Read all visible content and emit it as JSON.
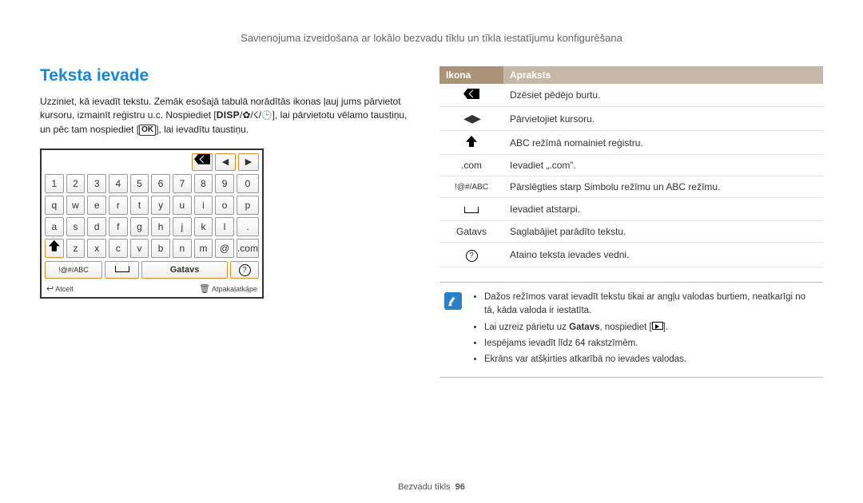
{
  "header": "Savienojuma izveidošana ar lokālo bezvadu tīklu un tīkla iestatījumu konfigurēšana",
  "section_title": "Teksta ievade",
  "intro_seg1": "Uzziniet, kā ievadīt tekstu. Zemāk esošajā tabulā norādītās ikonas ļauj jums pārvietot kursoru, izmainīt reģistru u.c. Nospiediet [",
  "intro_disp": "DISP",
  "intro_seg2": "], lai pārvietotu vēlamo taustiņu, un pēc tam nospiediet [",
  "intro_ok": "OK",
  "intro_seg3": "], lai ievadītu taustiņu.",
  "keyboard": {
    "rows": [
      [
        "1",
        "2",
        "3",
        "4",
        "5",
        "6",
        "7",
        "8",
        "9",
        "0"
      ],
      [
        "q",
        "w",
        "e",
        "r",
        "t",
        "y",
        "u",
        "i",
        "o",
        "p"
      ],
      [
        "a",
        "s",
        "d",
        "f",
        "g",
        "h",
        "j",
        "k",
        "l",
        "."
      ]
    ],
    "row4_keys": [
      "z",
      "x",
      "c",
      "v",
      "b",
      "n",
      "m",
      "@"
    ],
    "row4_com": ".com",
    "mode_key": "!@#/ABC",
    "done_key": "Gatavs",
    "footer_cancel": "Atcelt",
    "footer_back": "Atpakaļatkāpe"
  },
  "table": {
    "head_icon": "Ikona",
    "head_desc": "Apraksts",
    "rows": [
      {
        "desc": "Dzēsiet pēdējo burtu."
      },
      {
        "desc": "Pārvietojiet kursoru."
      },
      {
        "desc": "ABC režīmā nomainiet reģistru."
      },
      {
        "icon_text": ".com",
        "desc": "Ievadiet „.com”."
      },
      {
        "icon_text": "!@#/ABC",
        "desc": "Pārslēgties starp Simbolu režīmu un ABC režīmu."
      },
      {
        "desc": "Ievadiet atstarpi."
      },
      {
        "icon_text": "Gatavs",
        "desc": "Saglabājiet parādīto tekstu."
      },
      {
        "desc": "Ataino teksta ievades vedni."
      }
    ]
  },
  "infobox": {
    "li1": "Dažos režīmos varat ievadīt tekstu tikai ar angļu valodas burtiem, neatkarīgi no tā, kāda valoda ir iestatīta.",
    "li2_a": "Lai uzreiz pārietu uz ",
    "li2_bold": "Gatavs",
    "li2_b": ", nospiediet [",
    "li2_c": "].",
    "li3": "Iespējams ievadīt līdz 64 rakstzīmēm.",
    "li4": "Ekrāns var atšķirties atkarībā no ievades valodas."
  },
  "footer_label": "Bezvadu tīkls",
  "footer_page": "96"
}
